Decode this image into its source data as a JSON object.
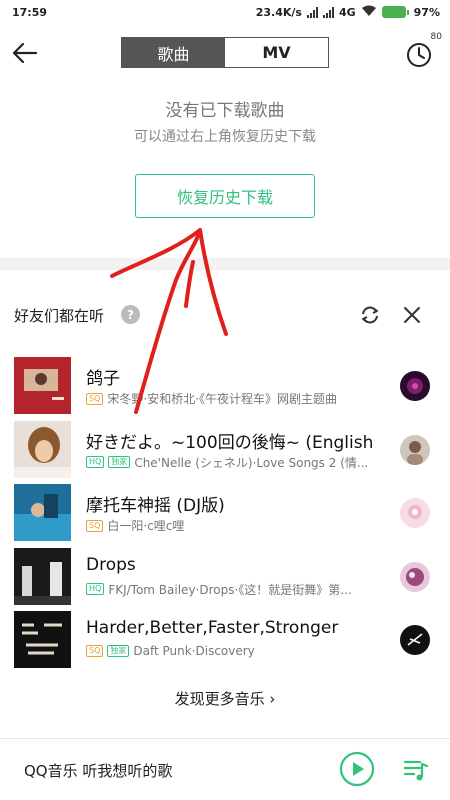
{
  "status_bar": {
    "time": "17:59",
    "net_speed": "23.4K/s",
    "network": "4G",
    "battery": "97%"
  },
  "header": {
    "tabs": [
      {
        "label": "歌曲",
        "active": true
      },
      {
        "label": "MV",
        "active": false
      }
    ],
    "timer_badge": "80"
  },
  "empty_state": {
    "title": "没有已下载歌曲",
    "subtitle": "可以通过右上角恢复历史下载",
    "restore_label": "恢复历史下载"
  },
  "friends_section": {
    "title": "好友们都在听",
    "help_label": "?",
    "songs": [
      {
        "title": "鸽子",
        "tags": [
          "SQ"
        ],
        "meta": "宋冬野·安和桥北·《午夜计程车》网剧主题曲"
      },
      {
        "title": "好きだよ。~100回の後悔~ (English",
        "tags": [
          "HQ",
          "独家"
        ],
        "meta": "Che'Nelle (シェネル)·Love Songs 2 (情..."
      },
      {
        "title": "摩托车神摇 (DJ版)",
        "tags": [
          "SQ"
        ],
        "meta": "白一阳·c哩c哩"
      },
      {
        "title": "Drops",
        "tags": [
          "HQ"
        ],
        "meta": "FKJ/Tom Bailey·Drops·《这！就是街舞》第..."
      },
      {
        "title": "Harder,Better,Faster,Stronger",
        "tags": [
          "SQ",
          "独家"
        ],
        "meta": "Daft Punk·Discovery"
      }
    ],
    "discover_more": "发现更多音乐 ›"
  },
  "player_bar": {
    "text": "QQ音乐 听我想听的歌"
  },
  "colors": {
    "accent": "#31c27c",
    "sq_tag": "#e8a23c",
    "annotation": "#e0201b"
  },
  "icons": [
    "back-arrow-icon",
    "timer-icon",
    "help-icon",
    "refresh-icon",
    "close-icon",
    "play-icon",
    "playlist-icon"
  ]
}
